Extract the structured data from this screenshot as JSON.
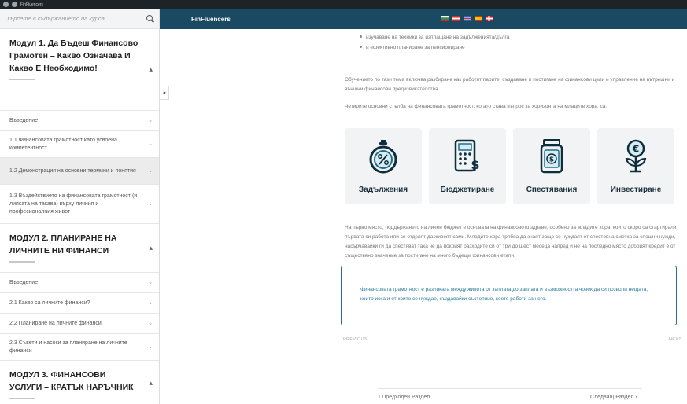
{
  "window": {
    "title": "FinFluencers"
  },
  "sidebar": {
    "search_placeholder": "Търсете в съдържанието на курса",
    "modules": [
      {
        "title": "Модул 1. Да Бъдеш Финансово Грамотен – Какво Означава И Какво Е Необходимо!",
        "toggle": "▴",
        "lessons": [
          {
            "label": "Въведение",
            "active": false
          },
          {
            "label": "1.1 Финансовата грамотност като усвоена компетентност",
            "active": false
          },
          {
            "label": "1.2 Демонстрация на основни термини и понятия",
            "active": true
          },
          {
            "label": "1.3 Въздействието на финансовата грамотност (и липсата на такава) върху личния и професионалния живот",
            "active": false
          }
        ]
      },
      {
        "title": "МОДУЛ 2. ПЛАНИРАНЕ НА ЛИЧНИТЕ НИ ФИНАНСИ",
        "toggle": "▴",
        "lessons": [
          {
            "label": "Въведение",
            "active": false
          },
          {
            "label": "2.1 Какво са личните финанси?",
            "active": false
          },
          {
            "label": "2.2 Планиране на личните финанси",
            "active": false
          },
          {
            "label": "2.3 Съвети и насоки за планиране на личните финанси",
            "active": false
          }
        ]
      },
      {
        "title": "МОДУЛ 3. ФИНАНСОВИ УСЛУГИ – КРАТЪК НАРЪЧНИК",
        "toggle": "▴",
        "lessons": []
      }
    ],
    "collapse_glyph": "◂"
  },
  "topbar": {
    "brand": "FinFluencers",
    "flags": [
      {
        "name": "flag-bulgaria",
        "colors": [
          "#ffffff",
          "#2f9a4a",
          "#d62828"
        ]
      },
      {
        "name": "flag-2",
        "colors": [
          "#d62828",
          "#ffffff",
          "#d62828"
        ]
      },
      {
        "name": "flag-3",
        "colors": [
          "#3a5bb5",
          "#ffffff",
          "#d62828"
        ]
      },
      {
        "name": "flag-4",
        "colors": [
          "#d62828",
          "#f2c400",
          "#d62828"
        ]
      },
      {
        "name": "flag-5",
        "colors": [
          "#c8102e",
          "#ffffff",
          "#c8102e"
        ]
      }
    ]
  },
  "main": {
    "bullets": [
      "изучаване на техники за изплащане на задълженията/дълга",
      "и ефективно планиране за пенсиониране"
    ],
    "para1": "Обучението по тази тема включва разбиране как работят парите, създаване и постигане на финансови цели и управление на вътрешни и външни финансови предизвикателства.",
    "para2": "Четирите основни стълба на финансовата грамотност, когато става въпрос за хоризонта на младите хора, са:",
    "cards": [
      {
        "label": "Задължения",
        "icon": "percent-stopwatch-icon"
      },
      {
        "label": "Бюджетиране",
        "icon": "calculator-dollar-icon"
      },
      {
        "label": "Спестявания",
        "icon": "money-jar-icon"
      },
      {
        "label": "Инвестиране",
        "icon": "euro-plant-icon"
      }
    ],
    "para3": "На първо място, поддържането на личен бюджет е основата на финансовото здраве, особено за младите хора, които скоро са стартирали първата си работа или се отделят да живеят сами. Младите хора трябва да знаят защо се нуждаят от спестовна сметка за спешни нужди, насърчавайки ги да спестяват така че да покрият разходите си от три до шест месеца напред и не на последно място добрият кредит е от съществено значение за постигане на много бъдещи финансови етапи.",
    "callout": "Финансовата грамотност е разликата между живота от заплата до заплата и възможността човек да си позволи нещата, които иска и от които се нуждае, създавайки състояние, което работи за него.",
    "prev_small": "PREVIOUS",
    "next_small": "NEXT",
    "prev_section": "‹  Предходен Раздел",
    "next_section": "Следващ Раздел  ›"
  },
  "colors": {
    "topbar": "#1a4a63",
    "icon_teal": "#1f6f8b",
    "icon_dark": "#0f2e3d",
    "callout_border": "#2e6c8f"
  }
}
